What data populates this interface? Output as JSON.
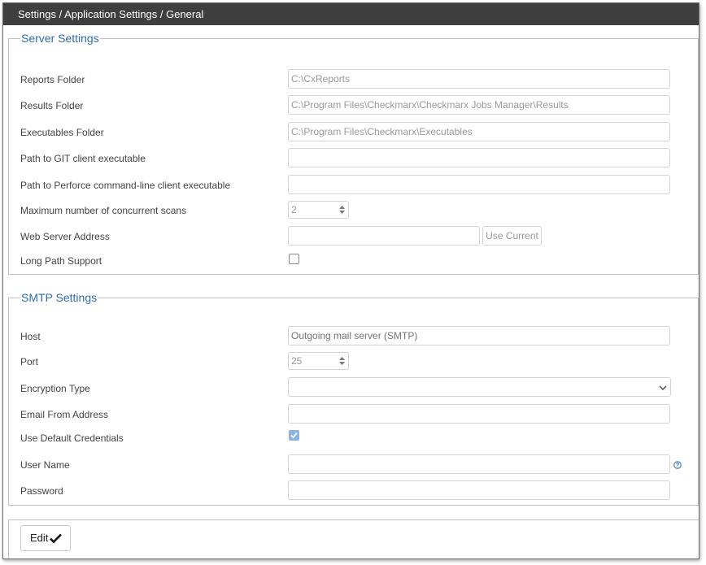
{
  "breadcrumb": "Settings / Application Settings / General",
  "server": {
    "title": "Server Settings",
    "reports_folder_label": "Reports Folder",
    "reports_folder_value": "C:\\CxReports",
    "results_folder_label": "Results Folder",
    "results_folder_value": "C:\\Program Files\\Checkmarx\\Checkmarx Jobs Manager\\Results",
    "executables_folder_label": "Executables Folder",
    "executables_folder_value": "C:\\Program Files\\Checkmarx\\Executables",
    "git_label": "Path to GIT client executable",
    "git_value": "",
    "perforce_label": "Path to Perforce command-line client executable",
    "perforce_value": "",
    "max_scans_label": "Maximum number of concurrent scans",
    "max_scans_value": "2",
    "web_server_label": "Web Server Address",
    "web_server_value": "",
    "use_current_label": "Use Current",
    "long_path_label": "Long Path Support",
    "long_path_checked": false
  },
  "smtp": {
    "title": "SMTP Settings",
    "host_label": "Host",
    "host_placeholder": "Outgoing mail server (SMTP)",
    "port_label": "Port",
    "port_value": "25",
    "encryption_label": "Encryption Type",
    "encryption_value": "",
    "email_from_label": "Email From Address",
    "email_from_value": "",
    "default_creds_label": "Use Default Credentials",
    "default_creds_checked": true,
    "username_label": "User Name",
    "username_value": "",
    "password_label": "Password",
    "password_value": ""
  },
  "actions": {
    "edit_label": "Edit"
  },
  "colors": {
    "titlebar": "#3e3e3e",
    "legend": "#2f6db5",
    "checkbox_checked": "#8ab4e8"
  }
}
